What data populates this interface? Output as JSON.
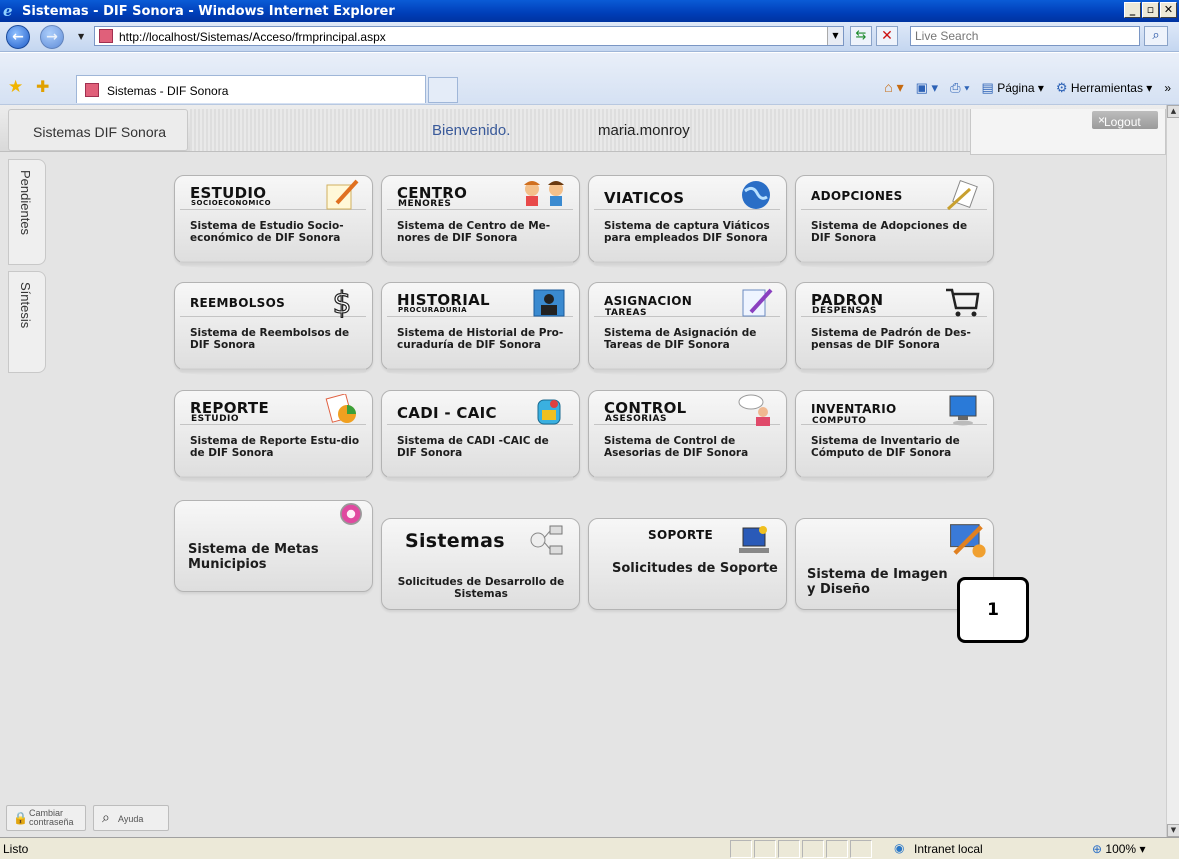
{
  "window": {
    "title": "Sistemas - DIF Sonora - Windows Internet Explorer"
  },
  "browser": {
    "url": "http://localhost/Sistemas/Acceso/frmprincipal.aspx",
    "search_placeholder": "Live Search",
    "tab_label": "Sistemas - DIF Sonora",
    "cmd_pagina": "Página",
    "cmd_herramientas": "Herramientas"
  },
  "app": {
    "brand": "Sistemas DIF Sonora",
    "welcome": "Bienvenido.",
    "username": "maria.monroy",
    "logout": "Logout"
  },
  "side_tabs": [
    "Pendientes",
    "Síntesis"
  ],
  "tiles": [
    {
      "t1": "ESTUDIO",
      "t2": "SOCIOECONOMICO",
      "desc": "Sistema de Estudio Socio-económico de DIF Sonora",
      "icon": "notepad-pencil-icon"
    },
    {
      "t1": "CENTRO",
      "t2": "MENORES",
      "desc": "Sistema de Centro de Me-nores de DIF Sonora",
      "icon": "children-icon"
    },
    {
      "t1": "VIATICOS",
      "t2": "",
      "desc": "Sistema de captura Viáticos para empleados DIF Sonora",
      "icon": "globe-icon"
    },
    {
      "t1": "ADOPCIONES",
      "t2": "",
      "desc": "Sistema de Adopciones de DIF Sonora",
      "icon": "documents-icon"
    },
    {
      "t1": "REEMBOLSOS",
      "t2": "",
      "desc": "Sistema de Reembolsos de DIF Sonora",
      "icon": "dollar-icon"
    },
    {
      "t1": "HISTORIAL",
      "t2": "PROCURADURIA",
      "desc": "Sistema de Historial de Pro-curaduría de DIF Sonora",
      "icon": "person-folder-icon"
    },
    {
      "t1": "ASIGNACION",
      "t2": "TAREAS",
      "desc": "Sistema de Asignación de Tareas de DIF Sonora",
      "icon": "task-edit-icon"
    },
    {
      "t1": "PADRON",
      "t2": "DESPENSAS",
      "desc": "Sistema de Padrón de Des-pensas de DIF Sonora",
      "icon": "shopping-cart-icon"
    },
    {
      "t1": "REPORTE",
      "t2": "ESTUDIO",
      "desc": "Sistema de Reporte Estu-dio de DIF Sonora",
      "icon": "report-chart-icon"
    },
    {
      "t1": "CADI - CAIC",
      "t2": "",
      "desc": "Sistema de CADI -CAIC de DIF Sonora",
      "icon": "backpack-icon"
    },
    {
      "t1": "CONTROL",
      "t2": "ASESORIAS",
      "desc": "Sistema de Control de Asesorias de DIF Sonora",
      "icon": "advisor-icon"
    },
    {
      "t1": "INVENTARIO",
      "t2": "COMPUTO",
      "desc": "Sistema de Inventario de Cómputo de DIF Sonora",
      "icon": "computer-icon"
    }
  ],
  "bottom_tiles": [
    {
      "title": "Sistema de Metas Municipios",
      "icon": "flower-icon"
    },
    {
      "header": "Sistemas",
      "title": "Solicitudes de Desarrollo de Sistemas",
      "icon": "network-icon"
    },
    {
      "header": "SOPORTE",
      "title": "Solicitudes de Soporte",
      "icon": "support-monitor-icon"
    },
    {
      "title": "Sistema de Imagen y Diseño",
      "icon": "paint-tools-icon"
    }
  ],
  "callout": "1",
  "footer": {
    "change_password": "Cambiar contraseña",
    "help": "Ayuda"
  },
  "status": {
    "text": "Listo",
    "zone": "Intranet local",
    "zoom": "100%"
  }
}
